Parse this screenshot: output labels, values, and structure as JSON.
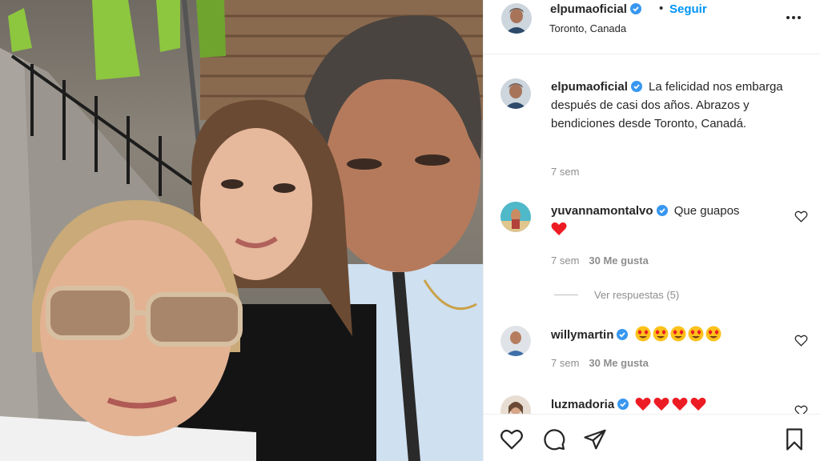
{
  "post": {
    "username": "elpumaoficial",
    "dot": "•",
    "follow_label": "Seguir",
    "location": "Toronto, Canada",
    "more_icon": "more-horizontal-icon"
  },
  "caption": {
    "username": "elpumaoficial",
    "text": "La felicidad nos embarga después de casi dos años. Abrazos y bendiciones desde Toronto, Canadá.",
    "time": "7 sem"
  },
  "comments": [
    {
      "username": "yuvannamontalvo",
      "text": "Que guapos",
      "emojis": [
        "red-heart"
      ],
      "time": "7 sem",
      "likes": "30 Me gusta",
      "replies": "Ver respuestas (5)"
    },
    {
      "username": "willymartin",
      "text": "",
      "emojis": [
        "heart-eyes",
        "heart-eyes",
        "heart-eyes",
        "heart-eyes",
        "heart-eyes"
      ],
      "time": "7 sem",
      "likes": "30 Me gusta"
    },
    {
      "username": "luzmadoria",
      "text": "",
      "emojis": [
        "red-heart",
        "red-heart",
        "red-heart",
        "red-heart"
      ]
    }
  ],
  "actions": [
    "like-icon",
    "comment-icon",
    "share-icon",
    "save-icon"
  ],
  "colors": {
    "accent": "#0095f6",
    "text": "#262626",
    "muted": "#8e8e8e",
    "heart": "#ed1c24",
    "divider": "#efefef"
  }
}
